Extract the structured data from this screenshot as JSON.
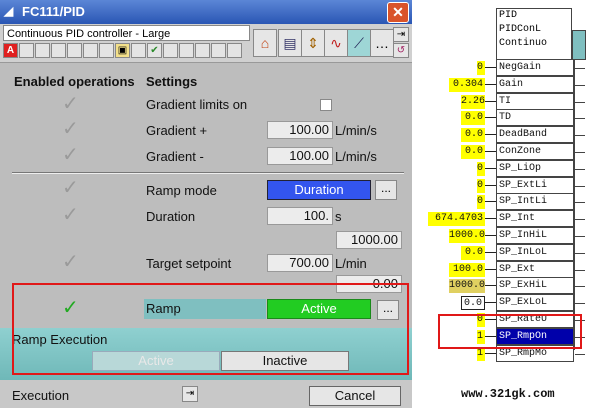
{
  "window": {
    "title": "FC111/PID",
    "block_name": "Continuous PID controller - Large",
    "alarm_flag": "A",
    "toolbar_icons": [
      "home-icon",
      "faceplate-icon",
      "limits-icon",
      "trend-icon",
      "curve-icon",
      "more-icon",
      "pin-icon",
      "return-icon"
    ]
  },
  "headers": {
    "enabled": "Enabled operations",
    "settings": "Settings"
  },
  "settings": {
    "gradient_limits_on": "Gradient limits on",
    "gradient_plus": {
      "label": "Gradient +",
      "value": "100.00",
      "unit": "L/min/s"
    },
    "gradient_minus": {
      "label": "Gradient -",
      "value": "100.00",
      "unit": "L/min/s"
    },
    "ramp_mode": {
      "label": "Ramp mode",
      "value": "Duration"
    },
    "duration": {
      "label": "Duration",
      "value": "100.",
      "unit": "s",
      "readback": "1000.00"
    },
    "target_setpoint": {
      "label": "Target setpoint",
      "value": "700.00",
      "unit": "L/min",
      "readback": "0.00"
    },
    "ramp": {
      "label": "Ramp",
      "status": "Active"
    },
    "dots": "..."
  },
  "ramp_execution": {
    "title": "Ramp Execution",
    "active_btn": "Active",
    "inactive_btn": "Inactive"
  },
  "footer": {
    "execution": "Execution",
    "cancel": "Cancel"
  },
  "function_block": {
    "header": [
      "PID",
      "PIDConL",
      "Continuo"
    ],
    "pins": [
      {
        "name": "NegGain",
        "value": "0"
      },
      {
        "name": "Gain",
        "value": "0.304"
      },
      {
        "name": "TI",
        "value": "2.26"
      },
      {
        "name": "TD",
        "value": "0.0"
      },
      {
        "name": "DeadBand",
        "value": "0.0"
      },
      {
        "name": "ConZone",
        "value": "0.0"
      },
      {
        "name": "SP_LiOp",
        "value": "0"
      },
      {
        "name": "SP_ExtLi",
        "value": "0"
      },
      {
        "name": "SP_IntLi",
        "value": "0"
      },
      {
        "name": "SP_Int",
        "value": "674.4703"
      },
      {
        "name": "SP_InHiL",
        "value": "1000.0"
      },
      {
        "name": "SP_InLoL",
        "value": "0.0"
      },
      {
        "name": "SP_Ext",
        "value": "100.0"
      },
      {
        "name": "SP_ExHiL",
        "value": "1000.0"
      },
      {
        "name": "SP_ExLoL",
        "value": "0.0"
      },
      {
        "name": "SP_RateU",
        "value": "0"
      },
      {
        "name": "SP_RmpOn",
        "value": "1"
      },
      {
        "name": "SP_RmpMo",
        "value": "1"
      }
    ]
  },
  "watermark": "www.321gk.com",
  "colors": {
    "title_bar": "#2a56b4",
    "active_green": "#22cc22",
    "duration_blue": "#3355ee",
    "highlight_red": "#e01818",
    "pin_yellow": "#ffff00",
    "selected_pin": "#0000aa"
  }
}
